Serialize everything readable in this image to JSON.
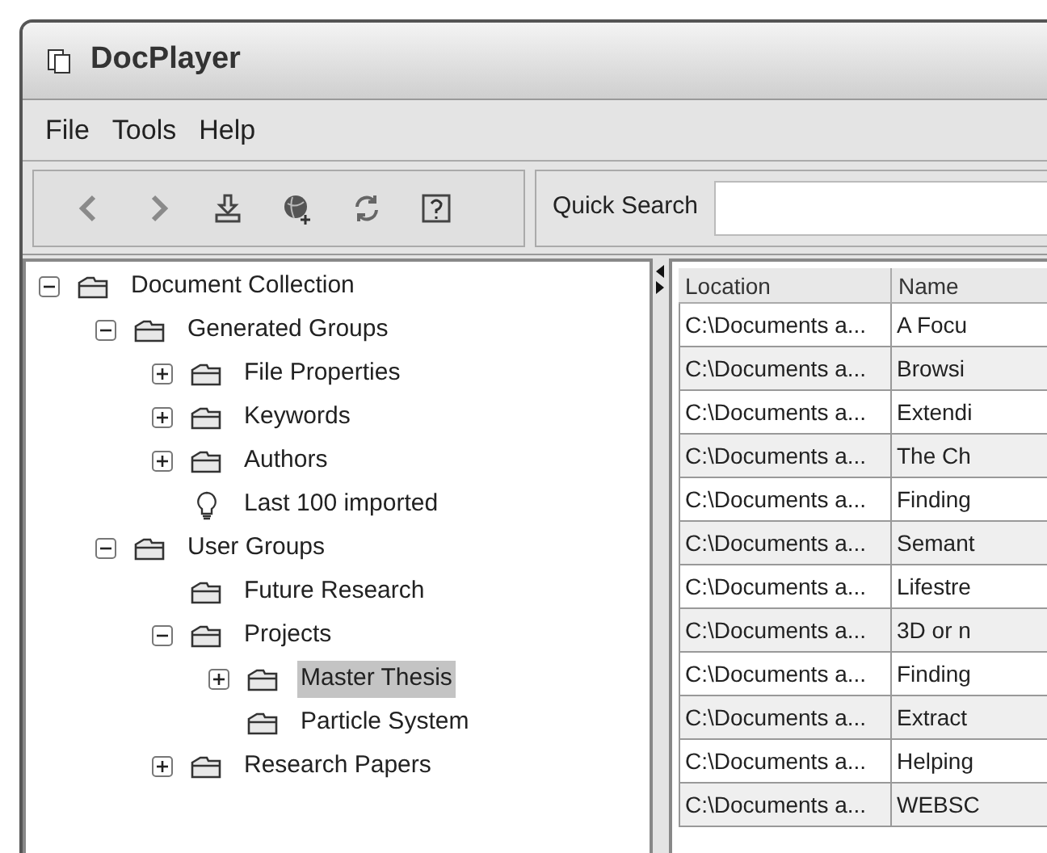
{
  "window": {
    "title": "DocPlayer"
  },
  "menu": [
    "File",
    "Tools",
    "Help"
  ],
  "toolbar": {
    "buttons": [
      {
        "kind": "back"
      },
      {
        "kind": "forward"
      },
      {
        "kind": "import"
      },
      {
        "kind": "web"
      },
      {
        "kind": "refresh"
      },
      {
        "kind": "help"
      }
    ],
    "search_label": "Quick Search"
  },
  "tree": [
    {
      "label": "Document Collection",
      "kind": "folder",
      "expanded": true,
      "selected": false,
      "children": [
        {
          "label": "Generated Groups",
          "kind": "folder",
          "expanded": true,
          "selected": false,
          "children": [
            {
              "label": "File Properties",
              "kind": "folder",
              "expanded": false,
              "selected": false
            },
            {
              "label": "Keywords",
              "kind": "folder",
              "expanded": false,
              "selected": false
            },
            {
              "label": "Authors",
              "kind": "folder",
              "expanded": false,
              "selected": false
            },
            {
              "label": "Last 100 imported",
              "kind": "bulb",
              "selected": false
            }
          ]
        },
        {
          "label": "User Groups",
          "kind": "folder",
          "expanded": true,
          "selected": false,
          "children": [
            {
              "label": "Future Research",
              "kind": "folder",
              "selected": false
            },
            {
              "label": "Projects",
              "kind": "folder",
              "expanded": true,
              "selected": false,
              "children": [
                {
                  "label": "Master Thesis",
                  "kind": "folder",
                  "expanded": false,
                  "selected": true
                },
                {
                  "label": "Particle System",
                  "kind": "folder",
                  "selected": false
                }
              ]
            },
            {
              "label": "Research Papers",
              "kind": "folder",
              "expanded": false,
              "selected": false
            }
          ]
        }
      ]
    }
  ],
  "table": {
    "columns": [
      "Location",
      "Name"
    ],
    "rows": [
      [
        "C:\\Documents a...",
        "A Focu"
      ],
      [
        "C:\\Documents a...",
        "Browsi"
      ],
      [
        "C:\\Documents a...",
        "Extendi"
      ],
      [
        "C:\\Documents a...",
        "The Ch"
      ],
      [
        "C:\\Documents a...",
        "Finding"
      ],
      [
        "C:\\Documents a...",
        "Semant"
      ],
      [
        "C:\\Documents a...",
        "Lifestre"
      ],
      [
        "C:\\Documents a...",
        "3D or n"
      ],
      [
        "C:\\Documents a...",
        "Finding"
      ],
      [
        "C:\\Documents a...",
        "Extract"
      ],
      [
        "C:\\Documents a...",
        "Helping"
      ],
      [
        "C:\\Documents a...",
        "WEBSC"
      ]
    ]
  }
}
